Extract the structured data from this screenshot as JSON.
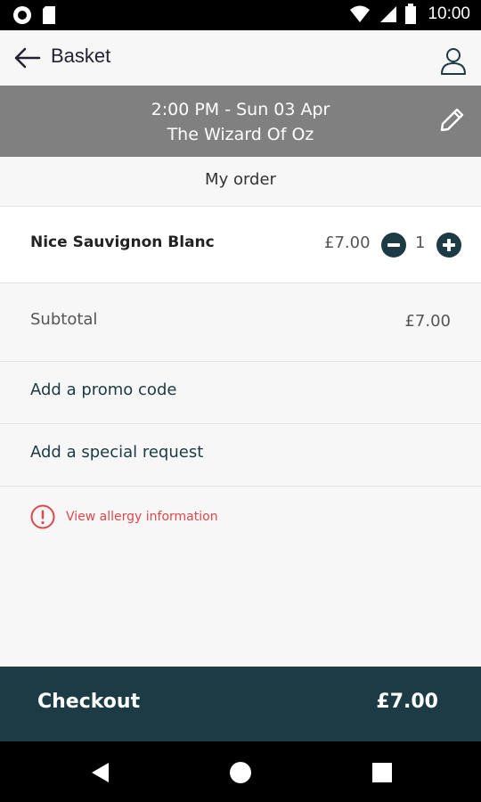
{
  "status_bar": {
    "time": "10:00",
    "icons": [
      "record-icon",
      "sd-card-icon",
      "wifi-icon",
      "signal-icon",
      "battery-icon"
    ]
  },
  "header": {
    "title": "Basket",
    "back_icon": "arrow-left-icon",
    "profile_icon": "user-icon"
  },
  "event": {
    "time_line": "2:00 PM - Sun 03 Apr",
    "show": "The Wizard Of Oz",
    "edit_icon": "pencil-icon"
  },
  "order": {
    "heading": "My order",
    "items": [
      {
        "name": "Nice Sauvignon Blanc",
        "price": "£7.00",
        "quantity": "1"
      }
    ],
    "subtotal_label": "Subtotal",
    "subtotal_value": "£7.00",
    "promo_label": "Add a promo code",
    "special_request_label": "Add a special request",
    "allergy_label": "View allergy information"
  },
  "checkout": {
    "label": "Checkout",
    "total": "£7.00"
  },
  "colors": {
    "accent": "#1c3b44",
    "banner": "#808080",
    "warning": "#e0474c"
  }
}
